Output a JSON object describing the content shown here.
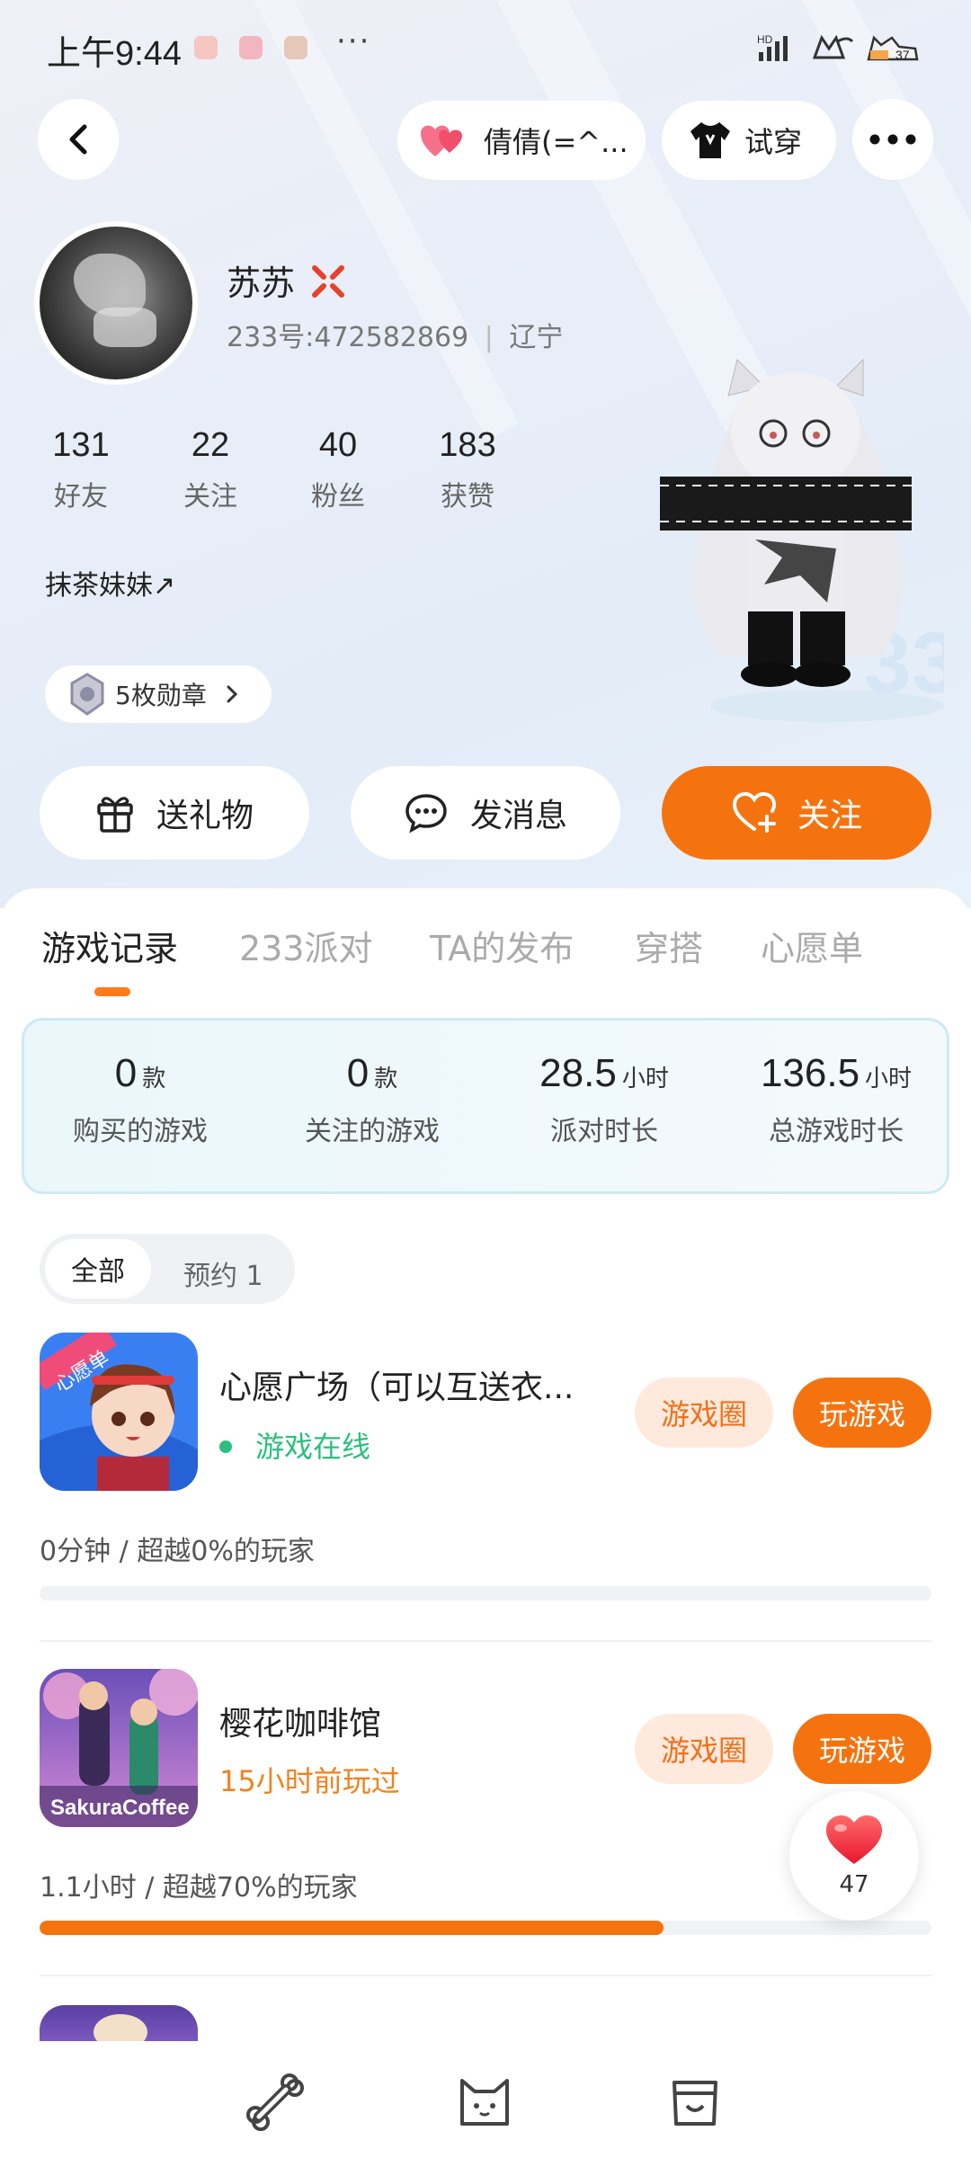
{
  "status_bar": {
    "time": "上午9:44",
    "more_label": "···",
    "battery_level": "37"
  },
  "top_bar": {
    "mood_label": "倩倩(=^...",
    "try_on_label": "试穿"
  },
  "profile": {
    "name": "苏苏",
    "id_text": "233号:472582869",
    "region": "辽宁",
    "stats": [
      {
        "num": "131",
        "label": "好友"
      },
      {
        "num": "22",
        "label": "关注"
      },
      {
        "num": "40",
        "label": "粉丝"
      },
      {
        "num": "183",
        "label": "获赞"
      }
    ],
    "bio": "抹茶妹妹↗",
    "badges_label": "5枚勋章"
  },
  "actions": {
    "gift": "送礼物",
    "message": "发消息",
    "follow": "关注"
  },
  "tabs": [
    "游戏记录",
    "233派对",
    "TA的发布",
    "穿搭",
    "心愿单"
  ],
  "summary": [
    {
      "value": "0",
      "unit": "款",
      "label": "购买的游戏"
    },
    {
      "value": "0",
      "unit": "款",
      "label": "关注的游戏"
    },
    {
      "value": "28.5",
      "unit": "小时",
      "label": "派对时长"
    },
    {
      "value": "136.5",
      "unit": "小时",
      "label": "总游戏时长"
    }
  ],
  "filter": {
    "all": "全部",
    "reserved": "预约 1"
  },
  "games": [
    {
      "title": "心愿广场（可以互送衣...",
      "status": "游戏在线",
      "status_color": "#2bbf7e",
      "circle_label": "游戏圈",
      "play_label": "玩游戏",
      "info": "0分钟 / 超越0%的玩家",
      "progress": 0,
      "icon_tag": "心愿单"
    },
    {
      "title": "樱花咖啡馆",
      "status": "15小时前玩过",
      "status_color": "#f0821e",
      "circle_label": "游戏圈",
      "play_label": "玩游戏",
      "info": "1.1小时 / 超越70%的玩家",
      "progress": 0.7,
      "icon_tag": "SakuraCoffee"
    }
  ],
  "like_fab": {
    "count": "47"
  },
  "colors": {
    "accent": "#f5730f",
    "accent_light": "#ffe9dc"
  }
}
